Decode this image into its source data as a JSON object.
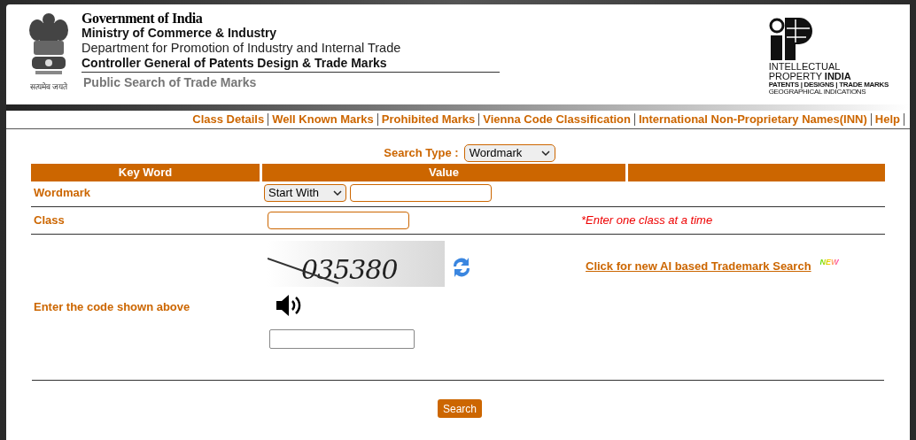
{
  "header": {
    "emblem_motto": "सत्यमेव जयते",
    "lines": [
      "Government of India",
      "Ministry of Commerce & Industry",
      "Department for Promotion of Industry and Internal Trade",
      "Controller General of Patents Design & Trade Marks"
    ],
    "subtitle": "Public Search of Trade Marks",
    "logo": {
      "line_1": "INTELLECTUAL",
      "line_2a": "PROPERTY",
      "line_2b": "INDIA",
      "line_3": "PATENTS | DESIGNS | TRADE MARKS",
      "line_4": "GEOGRAPHICAL INDICATIONS"
    }
  },
  "nav": [
    "Class Details",
    "Well Known Marks",
    "Prohibited Marks",
    "Vienna Code Classification",
    "International Non-Proprietary Names(INN)",
    "Help"
  ],
  "search_type": {
    "label": "Search Type :",
    "value": "Wordmark"
  },
  "table": {
    "columns": [
      "Key Word",
      "Value"
    ]
  },
  "rows": [
    {
      "kind": "wordmark",
      "label": "Wordmark",
      "select": "Start With"
    },
    {
      "kind": "class",
      "label": "Class",
      "note": "*Enter one class at a time"
    }
  ],
  "captcha": {
    "code": "035380",
    "label": "Enter the code shown above"
  },
  "ai_link": {
    "text": "Click for new AI based Trademark Search",
    "badge": "NEW"
  },
  "search_button": "Search"
}
